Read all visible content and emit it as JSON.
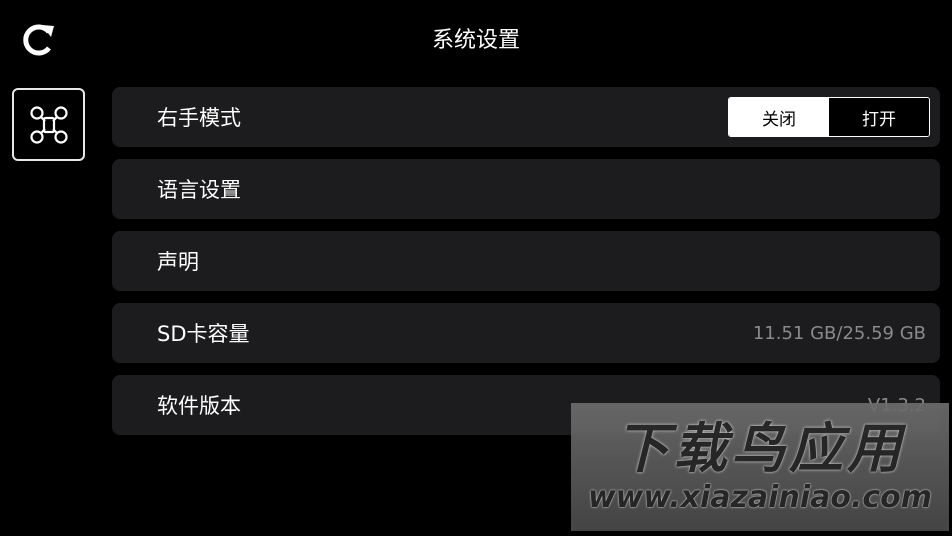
{
  "header": {
    "title": "系统设置",
    "back_icon": "refresh-icon"
  },
  "sidebar": {
    "tab_icon": "drone-icon",
    "tab_selected": true
  },
  "settings": {
    "hand_mode": {
      "label": "右手模式",
      "options": [
        "关闭",
        "打开"
      ],
      "selected": "关闭"
    },
    "language": {
      "label": "语言设置"
    },
    "statement": {
      "label": "声明"
    },
    "sd_card": {
      "label": "SD卡容量",
      "value": "11.51 GB/25.59 GB"
    },
    "software": {
      "label": "软件版本",
      "value": "V1.3.2"
    }
  },
  "watermark": {
    "title": "下载鸟应用",
    "url": "www.xiazainiao.com"
  },
  "colors": {
    "background": "#000000",
    "row_background": "#1c1c1e",
    "value_text": "#8a8a8a"
  }
}
